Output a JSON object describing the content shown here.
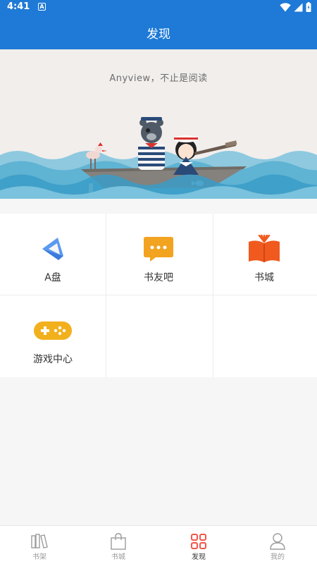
{
  "status_bar": {
    "time": "4:41",
    "notification_letter": "A",
    "icons": [
      "wifi-icon",
      "signal-icon",
      "battery-icon"
    ]
  },
  "header": {
    "title": "发现"
  },
  "banner": {
    "slogan": "Anyview，不止是阅读"
  },
  "grid": {
    "items": [
      {
        "label": "A盘",
        "icon": "a-drive-icon"
      },
      {
        "label": "书友吧",
        "icon": "chat-bubble-icon"
      },
      {
        "label": "书城",
        "icon": "book-icon"
      },
      {
        "label": "游戏中心",
        "icon": "gamepad-icon"
      }
    ]
  },
  "bottom_nav": {
    "items": [
      {
        "label": "书架",
        "icon": "bookshelf-icon"
      },
      {
        "label": "书城",
        "icon": "shopping-bag-icon"
      },
      {
        "label": "发现",
        "icon": "discover-grid-icon",
        "active": true
      },
      {
        "label": "我的",
        "icon": "person-icon"
      }
    ]
  },
  "colors": {
    "primary": "#1e7ad6",
    "active_nav": "#f0574a",
    "chat_orange": "#f2a31f",
    "book_orange": "#f05a1e",
    "a_drive_blue": "#5a9af0"
  }
}
